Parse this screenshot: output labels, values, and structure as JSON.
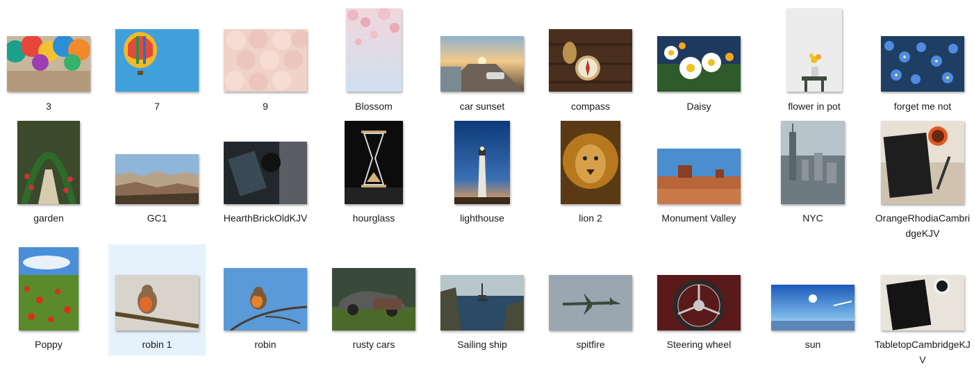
{
  "items": [
    {
      "name": "3",
      "icon": "balloons-photo-icon",
      "selected": false
    },
    {
      "name": "7",
      "icon": "hot-air-balloon-photo-icon",
      "selected": false
    },
    {
      "name": "9",
      "icon": "roses-photo-icon",
      "selected": false
    },
    {
      "name": "Blossom",
      "icon": "blossom-photo-icon",
      "selected": false
    },
    {
      "name": "car sunset",
      "icon": "car-sunset-photo-icon",
      "selected": false
    },
    {
      "name": "compass",
      "icon": "compass-photo-icon",
      "selected": false
    },
    {
      "name": "Daisy",
      "icon": "daisy-photo-icon",
      "selected": false
    },
    {
      "name": "flower in pot",
      "icon": "flower-pot-photo-icon",
      "selected": false
    },
    {
      "name": "forget me not",
      "icon": "forget-me-not-photo-icon",
      "selected": false
    },
    {
      "name": "garden",
      "icon": "garden-photo-icon",
      "selected": false
    },
    {
      "name": "GC1",
      "icon": "canyon-photo-icon",
      "selected": false
    },
    {
      "name": "HearthBrickOldKJV",
      "icon": "hearth-photo-icon",
      "selected": false
    },
    {
      "name": "hourglass",
      "icon": "hourglass-photo-icon",
      "selected": false
    },
    {
      "name": "lighthouse",
      "icon": "lighthouse-photo-icon",
      "selected": false
    },
    {
      "name": "lion 2",
      "icon": "lion-photo-icon",
      "selected": false
    },
    {
      "name": "Monument Valley",
      "icon": "monument-valley-photo-icon",
      "selected": false
    },
    {
      "name": "NYC",
      "icon": "nyc-photo-icon",
      "selected": false
    },
    {
      "name": "OrangeRhodiaCambridgeKJV",
      "icon": "notebook-photo-icon",
      "selected": false
    },
    {
      "name": "Poppy",
      "icon": "poppy-photo-icon",
      "selected": false
    },
    {
      "name": "robin 1",
      "icon": "robin-branch-photo-icon",
      "selected": true
    },
    {
      "name": "robin",
      "icon": "robin-sky-photo-icon",
      "selected": false
    },
    {
      "name": "rusty cars",
      "icon": "rusty-cars-photo-icon",
      "selected": false
    },
    {
      "name": "Sailing ship",
      "icon": "sailing-ship-photo-icon",
      "selected": false
    },
    {
      "name": "spitfire",
      "icon": "spitfire-photo-icon",
      "selected": false
    },
    {
      "name": "Steering wheel",
      "icon": "steering-wheel-photo-icon",
      "selected": false
    },
    {
      "name": "sun",
      "icon": "sun-photo-icon",
      "selected": false
    },
    {
      "name": "TabletopCambridgeKJV",
      "icon": "tabletop-bible-photo-icon",
      "selected": false
    }
  ]
}
